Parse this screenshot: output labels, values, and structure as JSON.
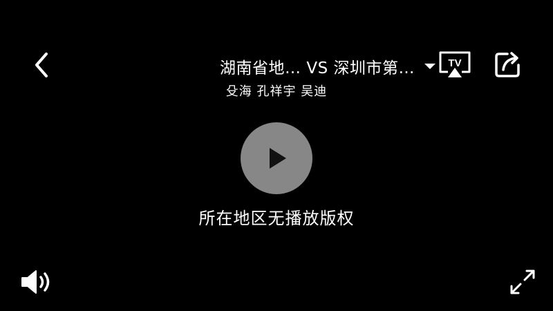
{
  "header": {
    "title": "湖南省地…  VS  深圳市第…",
    "participants": "殳海 孔祥宇 吴迪"
  },
  "player": {
    "message": "所在地区无播放版权",
    "tv_badge_text": "TV"
  },
  "icons": {
    "back": "back-arrow-icon",
    "dropdown": "chevron-down-icon",
    "tv": "tv-cast-icon",
    "share": "share-icon",
    "play": "play-icon",
    "volume": "volume-icon",
    "fullscreen": "fullscreen-icon"
  },
  "colors": {
    "background": "#000000",
    "foreground": "#ffffff",
    "play_circle": "#969696"
  }
}
